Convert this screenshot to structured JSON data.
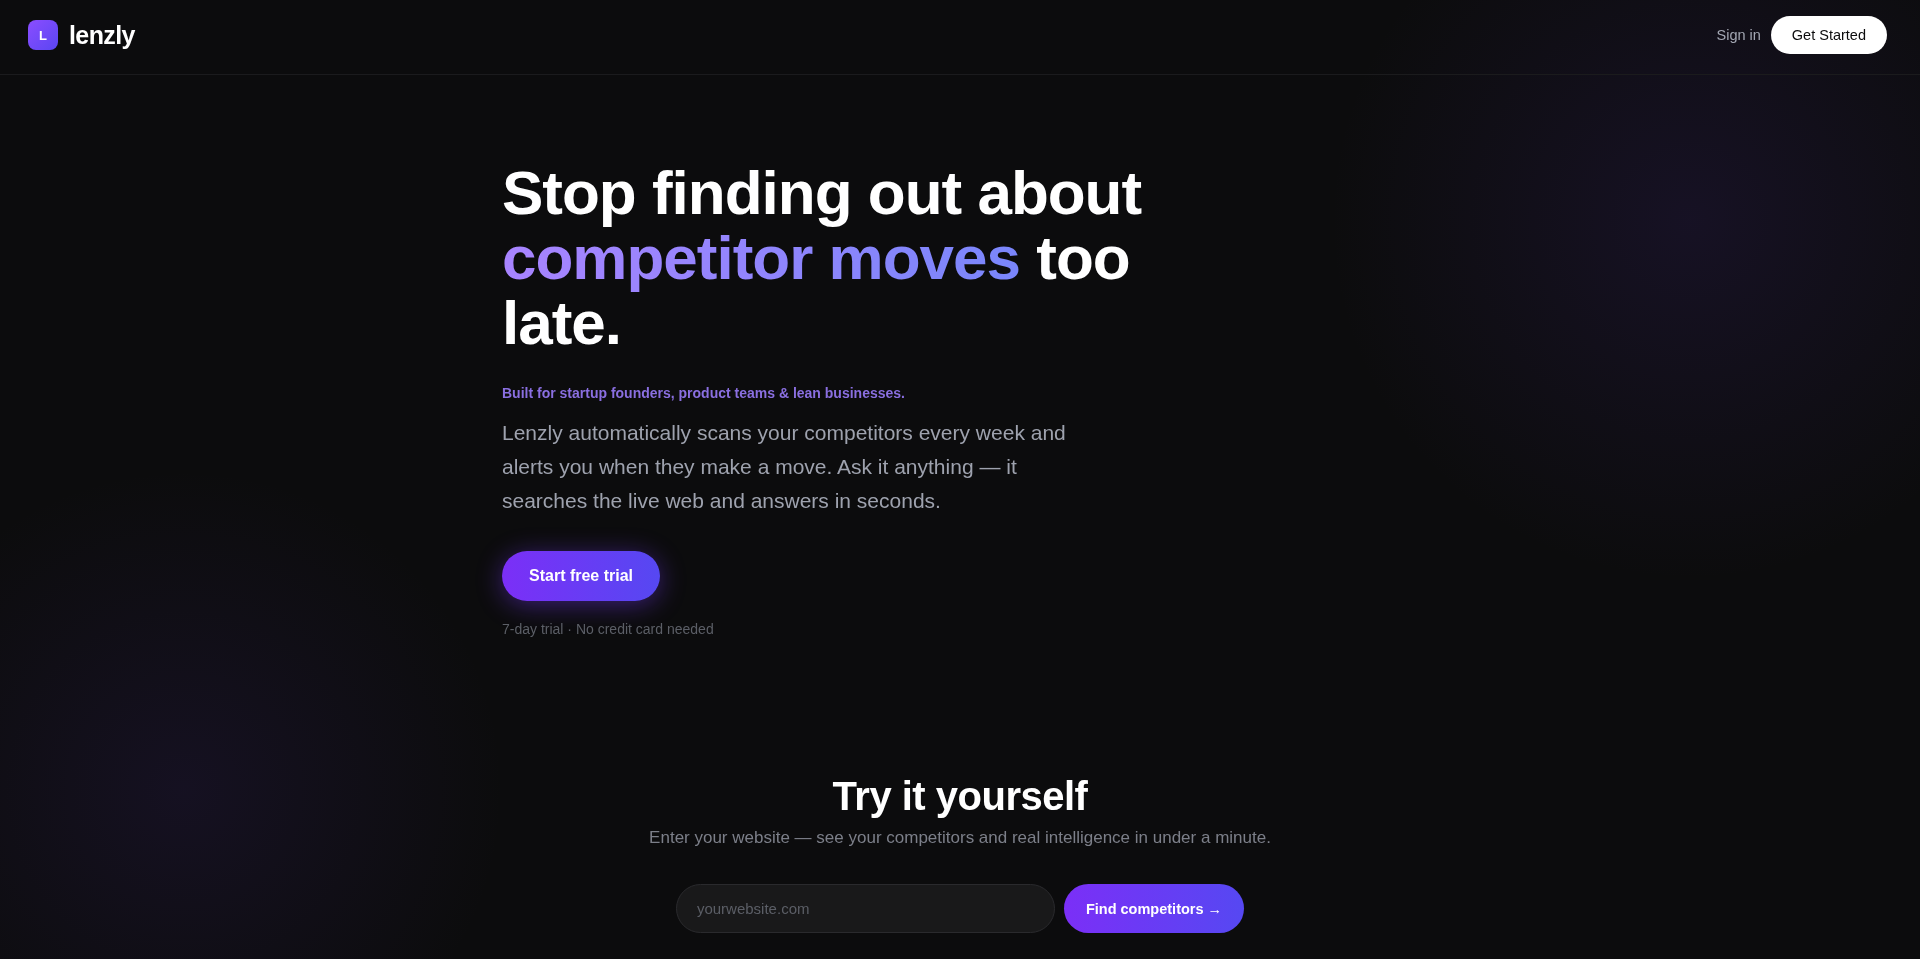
{
  "header": {
    "logo": {
      "mark": "L",
      "name": "lenzly"
    },
    "nav": {
      "sign_in": "Sign in",
      "cta": "Get Started"
    }
  },
  "hero": {
    "headline": [
      {
        "text": "Stop finding out about",
        "highlighted": false
      },
      {
        "text": "competitor moves",
        "highlighted": true
      },
      {
        "text": "too late.",
        "highlighted": false
      }
    ],
    "tagline": "Built for startup founders, product teams & lean businesses.",
    "description": "Lenzly automatically scans your competitors every week and alerts you when they make a move. Ask it anything — it searches the live web and answers in seconds.",
    "button": "Start free trial",
    "note": "7-day trial · No credit card needed"
  },
  "try_it": {
    "title": "Try it yourself",
    "subtitle": "Enter your website — see your competitors and real intelligence in under a minute.",
    "input": {
      "placeholder": "yourwebsite.com"
    },
    "button": "Find competitors →"
  }
}
